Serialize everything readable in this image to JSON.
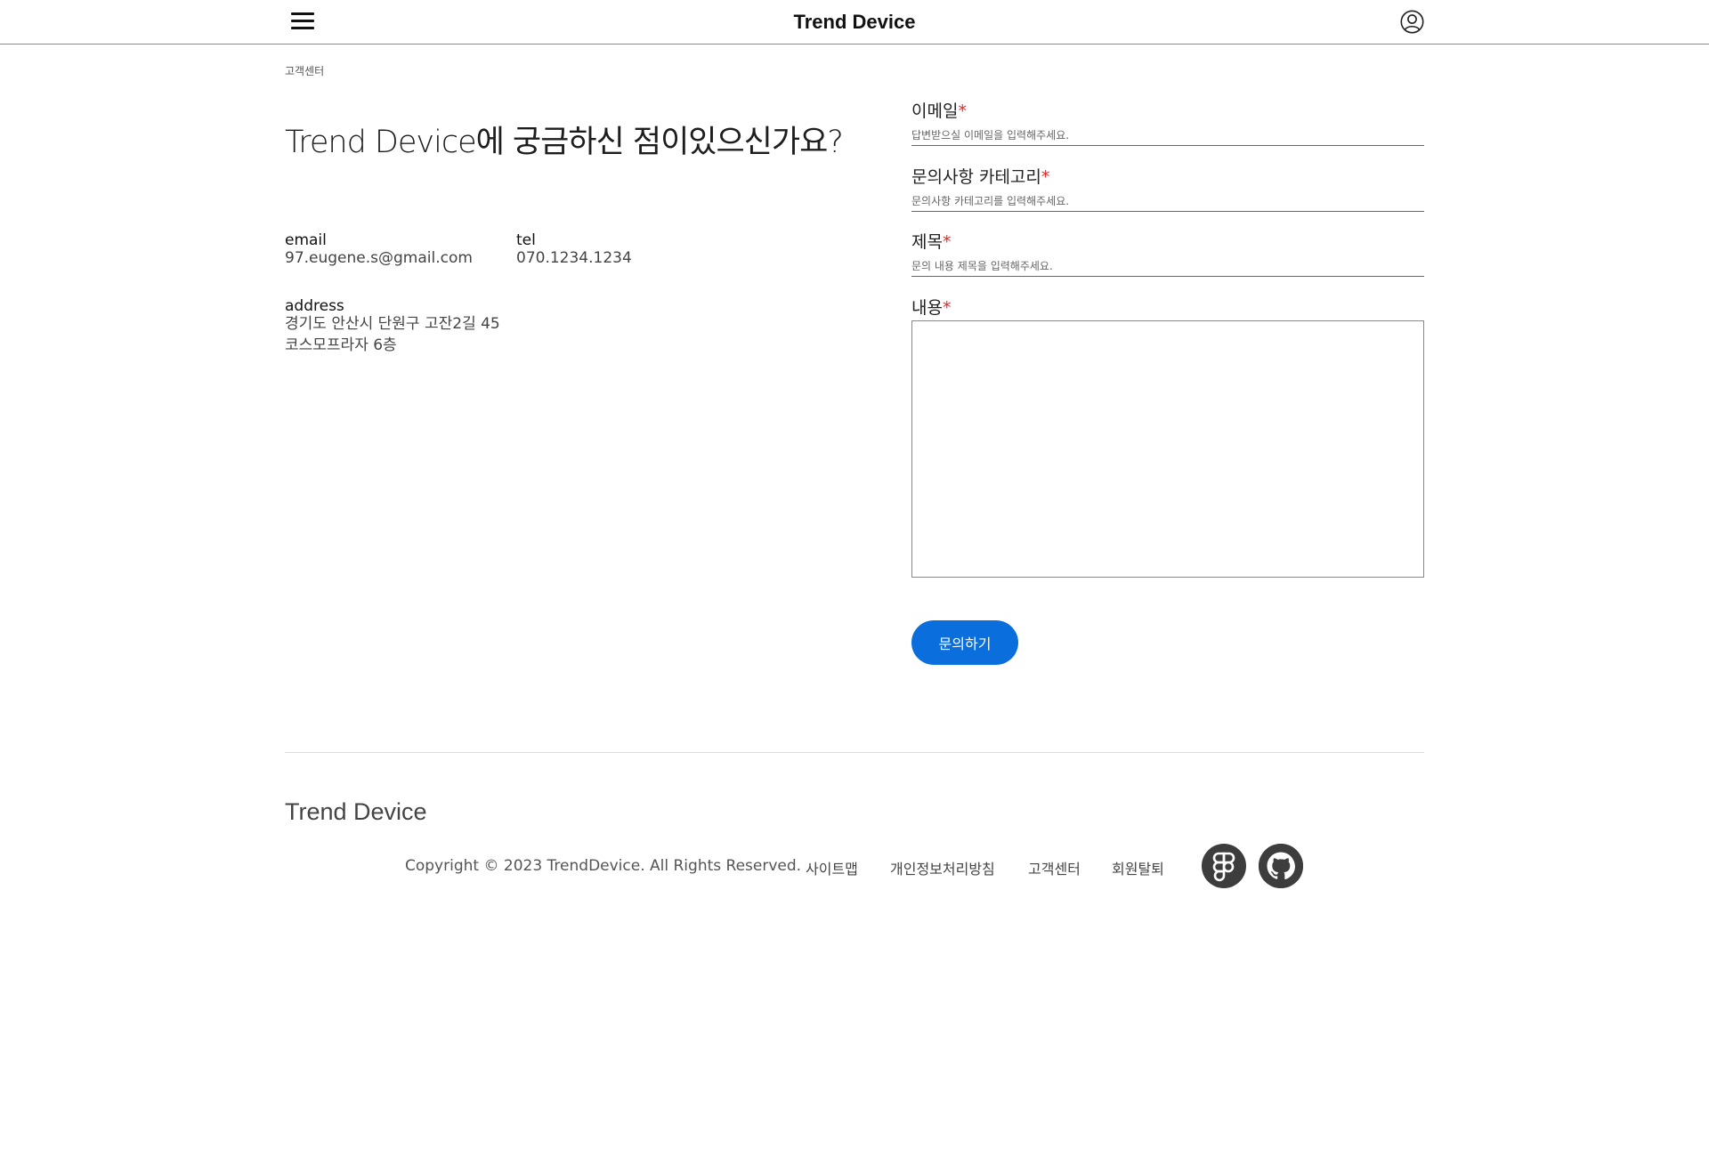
{
  "header": {
    "brand": "Trend Device",
    "menu_icon": "hamburger-menu-icon",
    "user_icon": "user-account-icon"
  },
  "breadcrumb": "고객센터",
  "headline": "Trend Device에 궁금하신 점이있으신가요?",
  "contact": {
    "email_label": "email",
    "email_value": "97.eugene.s@gmail.com",
    "tel_label": "tel",
    "tel_value": "070.1234.1234",
    "address_label": "address",
    "address_line1": "경기도 안산시 단원구 고잔2길 45",
    "address_line2": "코스모프라자 6층"
  },
  "form": {
    "email_label": "이메일",
    "email_placeholder": "답변받으실 이메일을 입력해주세요.",
    "category_label": "문의사항 카테고리",
    "category_placeholder": "문의사항 카테고리를 입력해주세요.",
    "title_label": "제목",
    "title_placeholder": "문의 내용 제목을 입력해주세요.",
    "content_label": "내용",
    "required_mark": "*",
    "submit_label": "문의하기"
  },
  "footer": {
    "brand": "Trend Device",
    "copyright": "Copyright © 2023 TrendDevice. All Rights Reserved.",
    "links": [
      "사이트맵",
      "개인정보처리방침",
      "고객센터",
      "회원탈퇴"
    ],
    "social_icons": [
      "figma-icon",
      "github-icon"
    ]
  },
  "colors": {
    "accent": "#0a6fdc",
    "required": "#e0282b"
  }
}
